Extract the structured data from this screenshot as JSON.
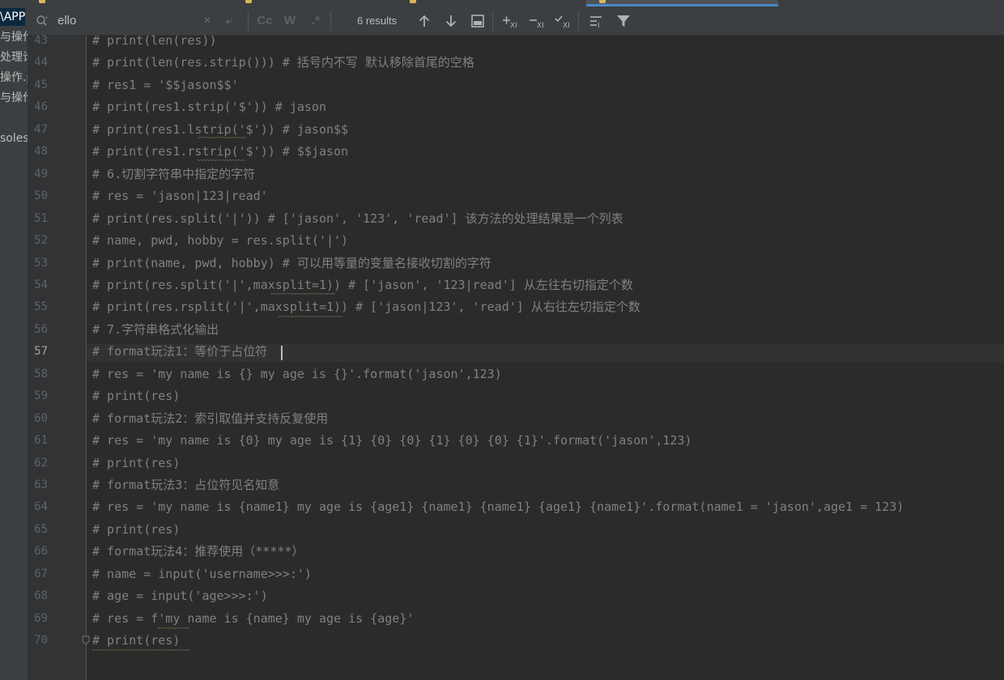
{
  "sidebar": {
    "items": [
      "\\APP",
      "与操作",
      "处理论",
      "操作.p",
      "与操作",
      "soles"
    ]
  },
  "search": {
    "query": "ello",
    "clear_glyph": "×",
    "replace_glyph": "⤶",
    "match_case_label": "Cc",
    "words_label": "W",
    "regex_label": ".*",
    "results_text": "6 results",
    "icons": [
      "search-icon",
      "close-icon",
      "newline-icon",
      "up-arrow-icon",
      "down-arrow-icon",
      "select-all-icon",
      "add-occurrence-icon",
      "remove-occurrence-icon",
      "select-occurrences-icon",
      "multiline-icon",
      "filter-icon"
    ]
  },
  "editor": {
    "current_line": "57",
    "lines": [
      {
        "no": "43",
        "text": "# print(len(res))"
      },
      {
        "no": "44",
        "text": "# print(len(res.strip())) # 括号内不写 默认移除首尾的空格"
      },
      {
        "no": "45",
        "text": "# res1 = '$$jason$$'"
      },
      {
        "no": "46",
        "text": "# print(res1.strip('$')) # jason"
      },
      {
        "no": "47",
        "text": "# print(res1.lstrip('$')) # jason$$"
      },
      {
        "no": "48",
        "text": "# print(res1.rstrip('$')) # $$jason"
      },
      {
        "no": "49",
        "text": "# 6.切割字符串中指定的字符"
      },
      {
        "no": "50",
        "text": "# res = 'jason|123|read'"
      },
      {
        "no": "51",
        "text": "# print(res.split('|')) # ['jason', '123', 'read'] 该方法的处理结果是一个列表"
      },
      {
        "no": "52",
        "text": "# name, pwd, hobby = res.split('|')"
      },
      {
        "no": "53",
        "text": "# print(name, pwd, hobby) # 可以用等量的变量名接收切割的字符"
      },
      {
        "no": "54",
        "text": "# print(res.split('|',maxsplit=1)) # ['jason', '123|read'] 从左往右切指定个数"
      },
      {
        "no": "55",
        "text": "# print(res.rsplit('|',maxsplit=1)) # ['jason|123', 'read'] 从右往左切指定个数"
      },
      {
        "no": "56",
        "text": "# 7.字符串格式化输出"
      },
      {
        "no": "57",
        "text": "# format玩法1：等价于占位符"
      },
      {
        "no": "58",
        "text": "# res = 'my name is {} my age is {}'.format('jason',123)"
      },
      {
        "no": "59",
        "text": "# print(res)"
      },
      {
        "no": "60",
        "text": "# format玩法2：索引取值并支持反复使用"
      },
      {
        "no": "61",
        "text": "# res = 'my name is {0} my age is {1} {0} {0} {1} {0} {0} {1}'.format('jason',123)"
      },
      {
        "no": "62",
        "text": "# print(res)"
      },
      {
        "no": "63",
        "text": "# format玩法3：占位符见名知意"
      },
      {
        "no": "64",
        "text": "# res = 'my name is {name1} my age is {age1} {name1} {name1} {age1} {name1}'.format(name1 = 'jason',age1 = 123)"
      },
      {
        "no": "65",
        "text": "# print(res)"
      },
      {
        "no": "66",
        "text": "# format玩法4：推荐使用（*****）"
      },
      {
        "no": "67",
        "text": "# name = input('username>>>:')"
      },
      {
        "no": "68",
        "text": "# age = input('age>>>:')"
      },
      {
        "no": "69",
        "text": "# res = f'my name is {name} my age is {age}'"
      },
      {
        "no": "70",
        "text": "# print(res)"
      }
    ]
  }
}
